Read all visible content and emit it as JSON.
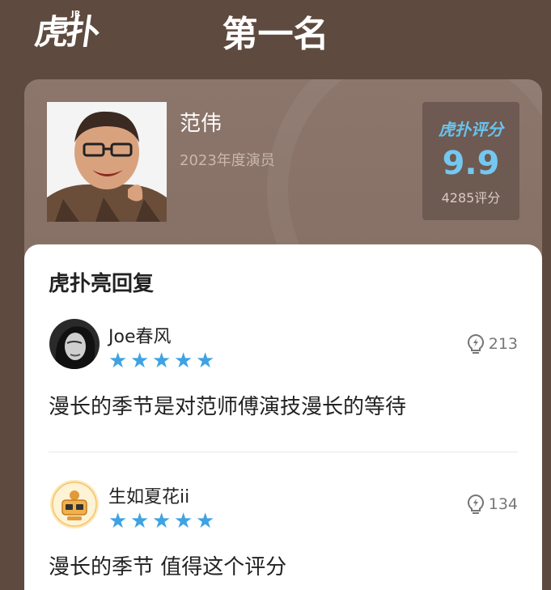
{
  "header": {
    "logo_text": "虎扑",
    "logo_sup": "JR",
    "rank_title": "第一名"
  },
  "profile": {
    "name": "范伟",
    "subtitle": "2023年度演员",
    "photo_icon": "person-photo"
  },
  "score": {
    "brand": "虎扑评分",
    "value": "9.9",
    "count": "4285评分",
    "accent_color": "#74c8f0"
  },
  "replies_section": {
    "title": "虎扑亮回复",
    "replies": [
      {
        "username": "Joe春风",
        "stars": 5,
        "light_count": "213",
        "text": "漫长的季节是对范师傅演技漫长的等待"
      },
      {
        "username": "生如夏花ii",
        "stars": 5,
        "light_count": "134",
        "text": "漫长的季节 值得这个评分"
      }
    ]
  },
  "colors": {
    "background": "#5e4a3e",
    "card": "#8c766c",
    "star": "#3ea2e3"
  }
}
